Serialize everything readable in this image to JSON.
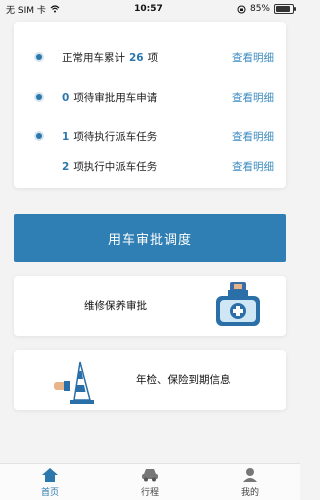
{
  "status_bar": {
    "carrier": "无 SIM 卡",
    "time": "10:57",
    "battery": "85%",
    "battery_level": 0.85
  },
  "stats": [
    {
      "prefix": "正常用车累计",
      "count": "26",
      "suffix": "项",
      "link": "查看明细",
      "dot": true
    },
    {
      "prefix": "",
      "count": "0",
      "suffix": "项待审批用车申请",
      "link": "查看明细",
      "dot": true
    },
    {
      "prefix": "",
      "count": "1",
      "suffix": "项待执行派车任务",
      "link": "查看明细",
      "dot": true
    },
    {
      "prefix": "",
      "count": "2",
      "suffix": "项执行中派车任务",
      "link": "查看明细",
      "dot": false
    }
  ],
  "main_button_label": "用车审批调度",
  "features": {
    "maintenance": {
      "label": "维修保养审批",
      "icon": "medical-kit-icon"
    },
    "inspection": {
      "label": "年检、保险到期信息",
      "icon": "traffic-cone-icon"
    }
  },
  "tabs": [
    {
      "label": "首页",
      "icon": "home-icon",
      "active": true
    },
    {
      "label": "行程",
      "icon": "car-icon",
      "active": false
    },
    {
      "label": "我的",
      "icon": "user-icon",
      "active": false
    }
  ],
  "colors": {
    "accent": "#2f7fb4",
    "link": "#3b8bbf",
    "active_tab": "#2c78ac"
  }
}
